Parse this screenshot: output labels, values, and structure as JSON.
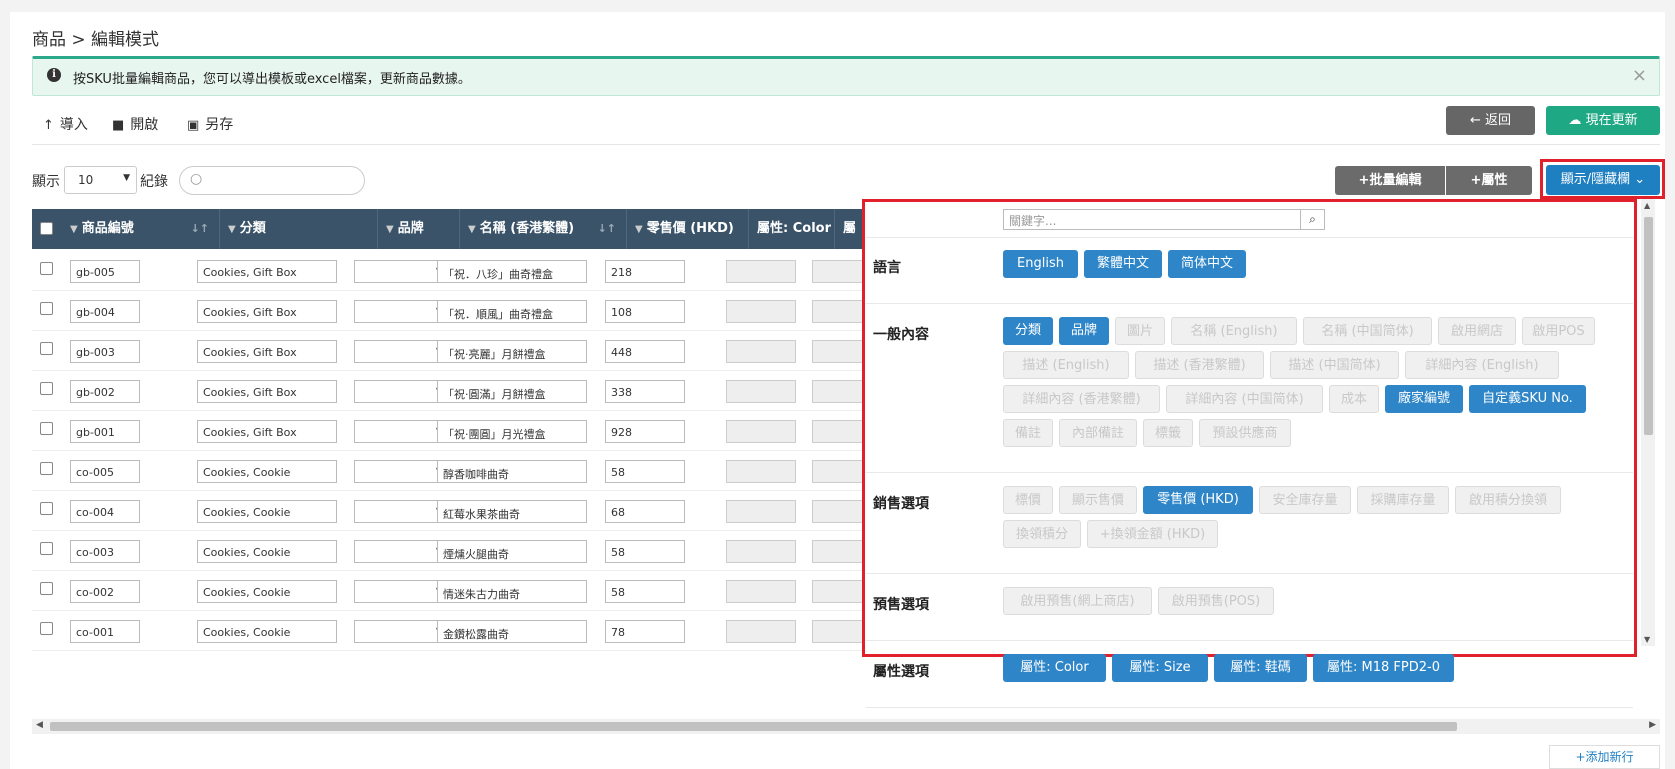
{
  "page_title": "商品 > 編輯模式",
  "alert": {
    "icon": "info-icon",
    "text": "按SKU批量編輯商品，您可以導出模板或excel檔案，更新商品數據。",
    "close": "×"
  },
  "toolbar": {
    "import": "導入",
    "open": "開啟",
    "save_as": "另存",
    "back": "返回",
    "update_now": "現在更新"
  },
  "list_controls": {
    "show_label": "顯示",
    "page_size": "10",
    "records_label": "紀錄",
    "search_placeholder": ""
  },
  "actions": {
    "batch_edit": "批量編輯",
    "attribute": "屬性",
    "toggle_columns": "顯示/隱藏欄"
  },
  "table": {
    "headers": [
      "商品編號",
      "分類",
      "品牌",
      "名稱 (香港繁體)",
      "零售價 (HKD)",
      "屬性: Color",
      "屬性: Si"
    ],
    "rows": [
      {
        "sku": "gb-005",
        "category": "Cookies, Gift Box",
        "brand": "",
        "name": "「祝．八珍」曲奇禮盒",
        "price": "218"
      },
      {
        "sku": "gb-004",
        "category": "Cookies, Gift Box",
        "brand": "",
        "name": "「祝．順風」曲奇禮盒",
        "price": "108"
      },
      {
        "sku": "gb-003",
        "category": "Cookies, Gift Box",
        "brand": "",
        "name": "「祝‧亮麗」月餅禮盒",
        "price": "448"
      },
      {
        "sku": "gb-002",
        "category": "Cookies, Gift Box",
        "brand": "",
        "name": "「祝‧圓滿」月餅禮盒",
        "price": "338"
      },
      {
        "sku": "gb-001",
        "category": "Cookies, Gift Box",
        "brand": "",
        "name": "「祝‧團圓」月光禮盒",
        "price": "928"
      },
      {
        "sku": "co-005",
        "category": "Cookies, Cookie",
        "brand": "",
        "name": "醇香咖啡曲奇",
        "price": "58"
      },
      {
        "sku": "co-004",
        "category": "Cookies, Cookie",
        "brand": "",
        "name": "紅莓水果茶曲奇",
        "price": "68"
      },
      {
        "sku": "co-003",
        "category": "Cookies, Cookie",
        "brand": "",
        "name": "煙燻火腿曲奇",
        "price": "58"
      },
      {
        "sku": "co-002",
        "category": "Cookies, Cookie",
        "brand": "",
        "name": "情迷朱古力曲奇",
        "price": "58"
      },
      {
        "sku": "co-001",
        "category": "Cookies, Cookie",
        "brand": "",
        "name": "金鑽松露曲奇",
        "price": "78"
      }
    ]
  },
  "add_row": "添加新行",
  "column_panel": {
    "keyword_placeholder": "關鍵字...",
    "groups": [
      {
        "label": "語言",
        "tags": [
          {
            "text": "English",
            "on": true
          },
          {
            "text": "繁體中文",
            "on": true
          },
          {
            "text": "简体中文",
            "on": true
          }
        ]
      },
      {
        "label": "一般內容",
        "tags": [
          {
            "text": "分類",
            "on": true
          },
          {
            "text": "品牌",
            "on": true
          },
          {
            "text": "圖片",
            "on": false
          },
          {
            "text": "名稱 (English)",
            "on": false
          },
          {
            "text": "名稱 (中国简体)",
            "on": false
          },
          {
            "text": "啟用網店",
            "on": false
          },
          {
            "text": "啟用POS",
            "on": false
          },
          {
            "text": "描述 (English)",
            "on": false
          },
          {
            "text": "描述 (香港繁體)",
            "on": false
          },
          {
            "text": "描述 (中国简体)",
            "on": false
          },
          {
            "text": "詳細內容 (English)",
            "on": false
          },
          {
            "text": "詳細內容 (香港繁體)",
            "on": false
          },
          {
            "text": "詳細內容 (中国简体)",
            "on": false
          },
          {
            "text": "成本",
            "on": false
          },
          {
            "text": "廠家編號",
            "on": true
          },
          {
            "text": "自定義SKU No.",
            "on": true
          },
          {
            "text": "備註",
            "on": false
          },
          {
            "text": "內部備註",
            "on": false
          },
          {
            "text": "標籤",
            "on": false
          },
          {
            "text": "預設供應商",
            "on": false
          }
        ]
      },
      {
        "label": "銷售選項",
        "tags": [
          {
            "text": "標價",
            "on": false
          },
          {
            "text": "顯示售價",
            "on": false
          },
          {
            "text": "零售價 (HKD)",
            "on": true
          },
          {
            "text": "安全庫存量",
            "on": false
          },
          {
            "text": "採購庫存量",
            "on": false
          },
          {
            "text": "啟用積分換領",
            "on": false
          },
          {
            "text": "換領積分",
            "on": false
          },
          {
            "text": "+換領金額 (HKD)",
            "on": false
          }
        ]
      },
      {
        "label": "預售選項",
        "tags": [
          {
            "text": "啟用預售(網上商店)",
            "on": false
          },
          {
            "text": "啟用預售(POS)",
            "on": false
          }
        ]
      },
      {
        "label": "屬性選項",
        "tags": [
          {
            "text": "屬性: Color",
            "on": true
          },
          {
            "text": "屬性: Size",
            "on": true
          },
          {
            "text": "屬性: 鞋碼",
            "on": true
          },
          {
            "text": "屬性: M18 FPD2-0",
            "on": true
          }
        ]
      }
    ]
  },
  "colors": {
    "header": "#3a5369",
    "accent": "#2e86c9",
    "success": "#1fa884",
    "highlight": "#e0202a"
  }
}
